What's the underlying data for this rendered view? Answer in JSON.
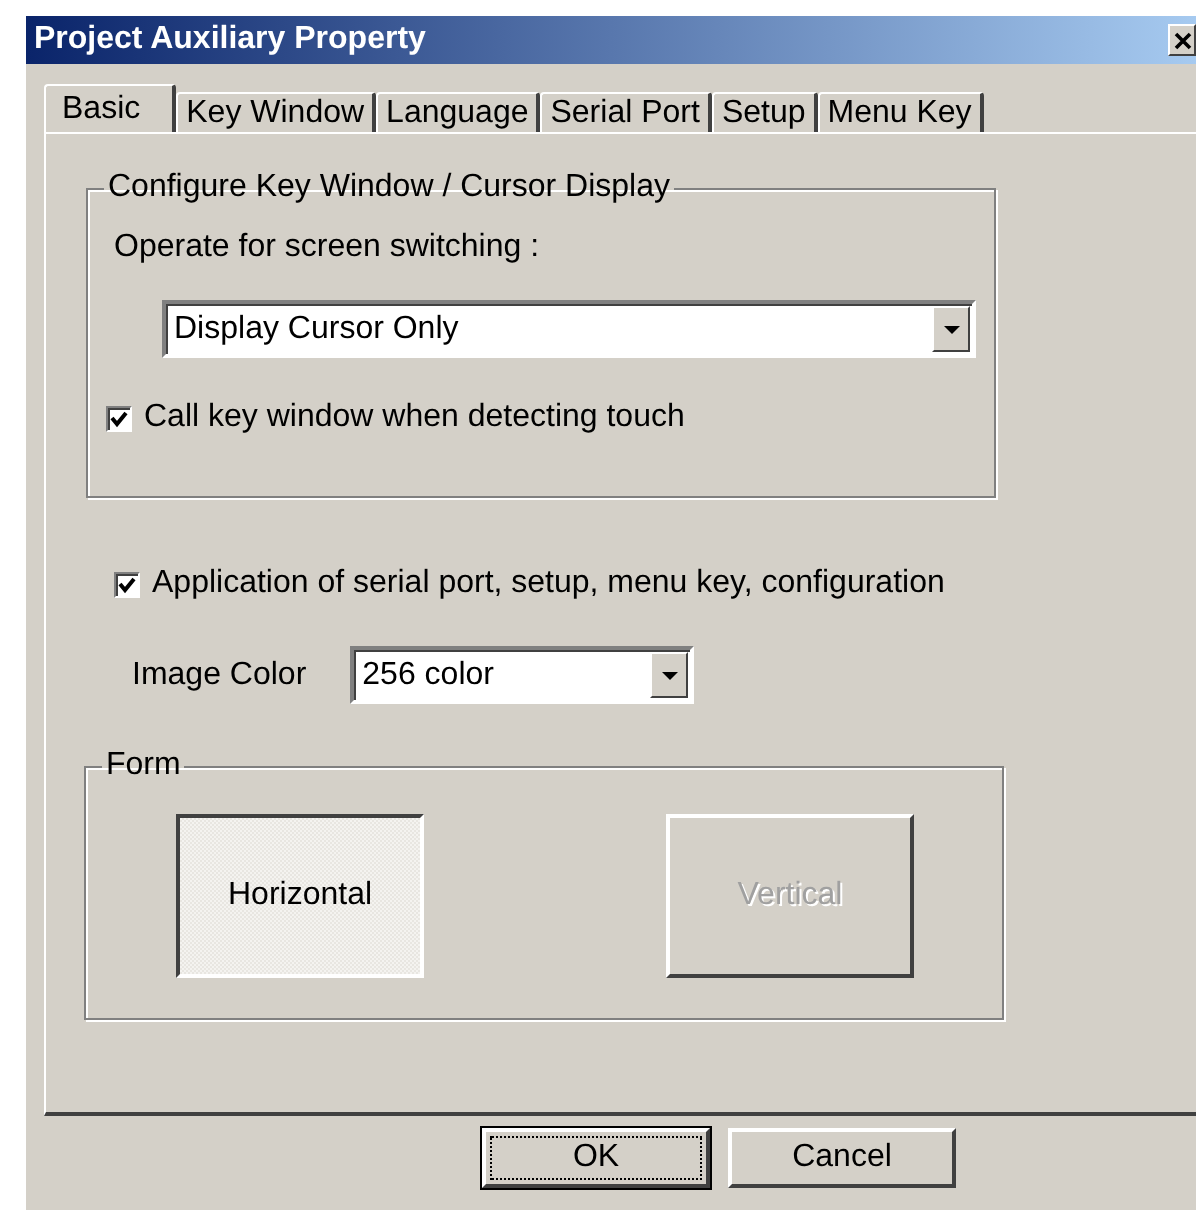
{
  "window": {
    "title": "Project Auxiliary Property"
  },
  "tabs": [
    {
      "label": "Basic",
      "selected": true
    },
    {
      "label": "Key Window",
      "selected": false
    },
    {
      "label": "Language",
      "selected": false
    },
    {
      "label": "Serial Port",
      "selected": false
    },
    {
      "label": "Setup",
      "selected": false
    },
    {
      "label": "Menu Key",
      "selected": false
    }
  ],
  "key_window_group": {
    "title": "Configure Key Window / Cursor Display",
    "switching_label": "Operate for screen switching :",
    "switching_value": "Display Cursor Only",
    "touch_option": {
      "label": "Call key window when detecting touch",
      "checked": true
    }
  },
  "apply_option": {
    "label": "Application of serial port, setup, menu key, configuration",
    "checked": true
  },
  "image_color": {
    "label": "Image Color",
    "value": "256 color"
  },
  "form_group": {
    "title": "Form",
    "options": [
      {
        "label": "Horizontal",
        "selected": true,
        "disabled": false
      },
      {
        "label": "Vertical",
        "selected": false,
        "disabled": true
      }
    ]
  },
  "buttons": [
    {
      "label": "OK",
      "focused": true
    },
    {
      "label": "Cancel",
      "focused": false
    }
  ]
}
